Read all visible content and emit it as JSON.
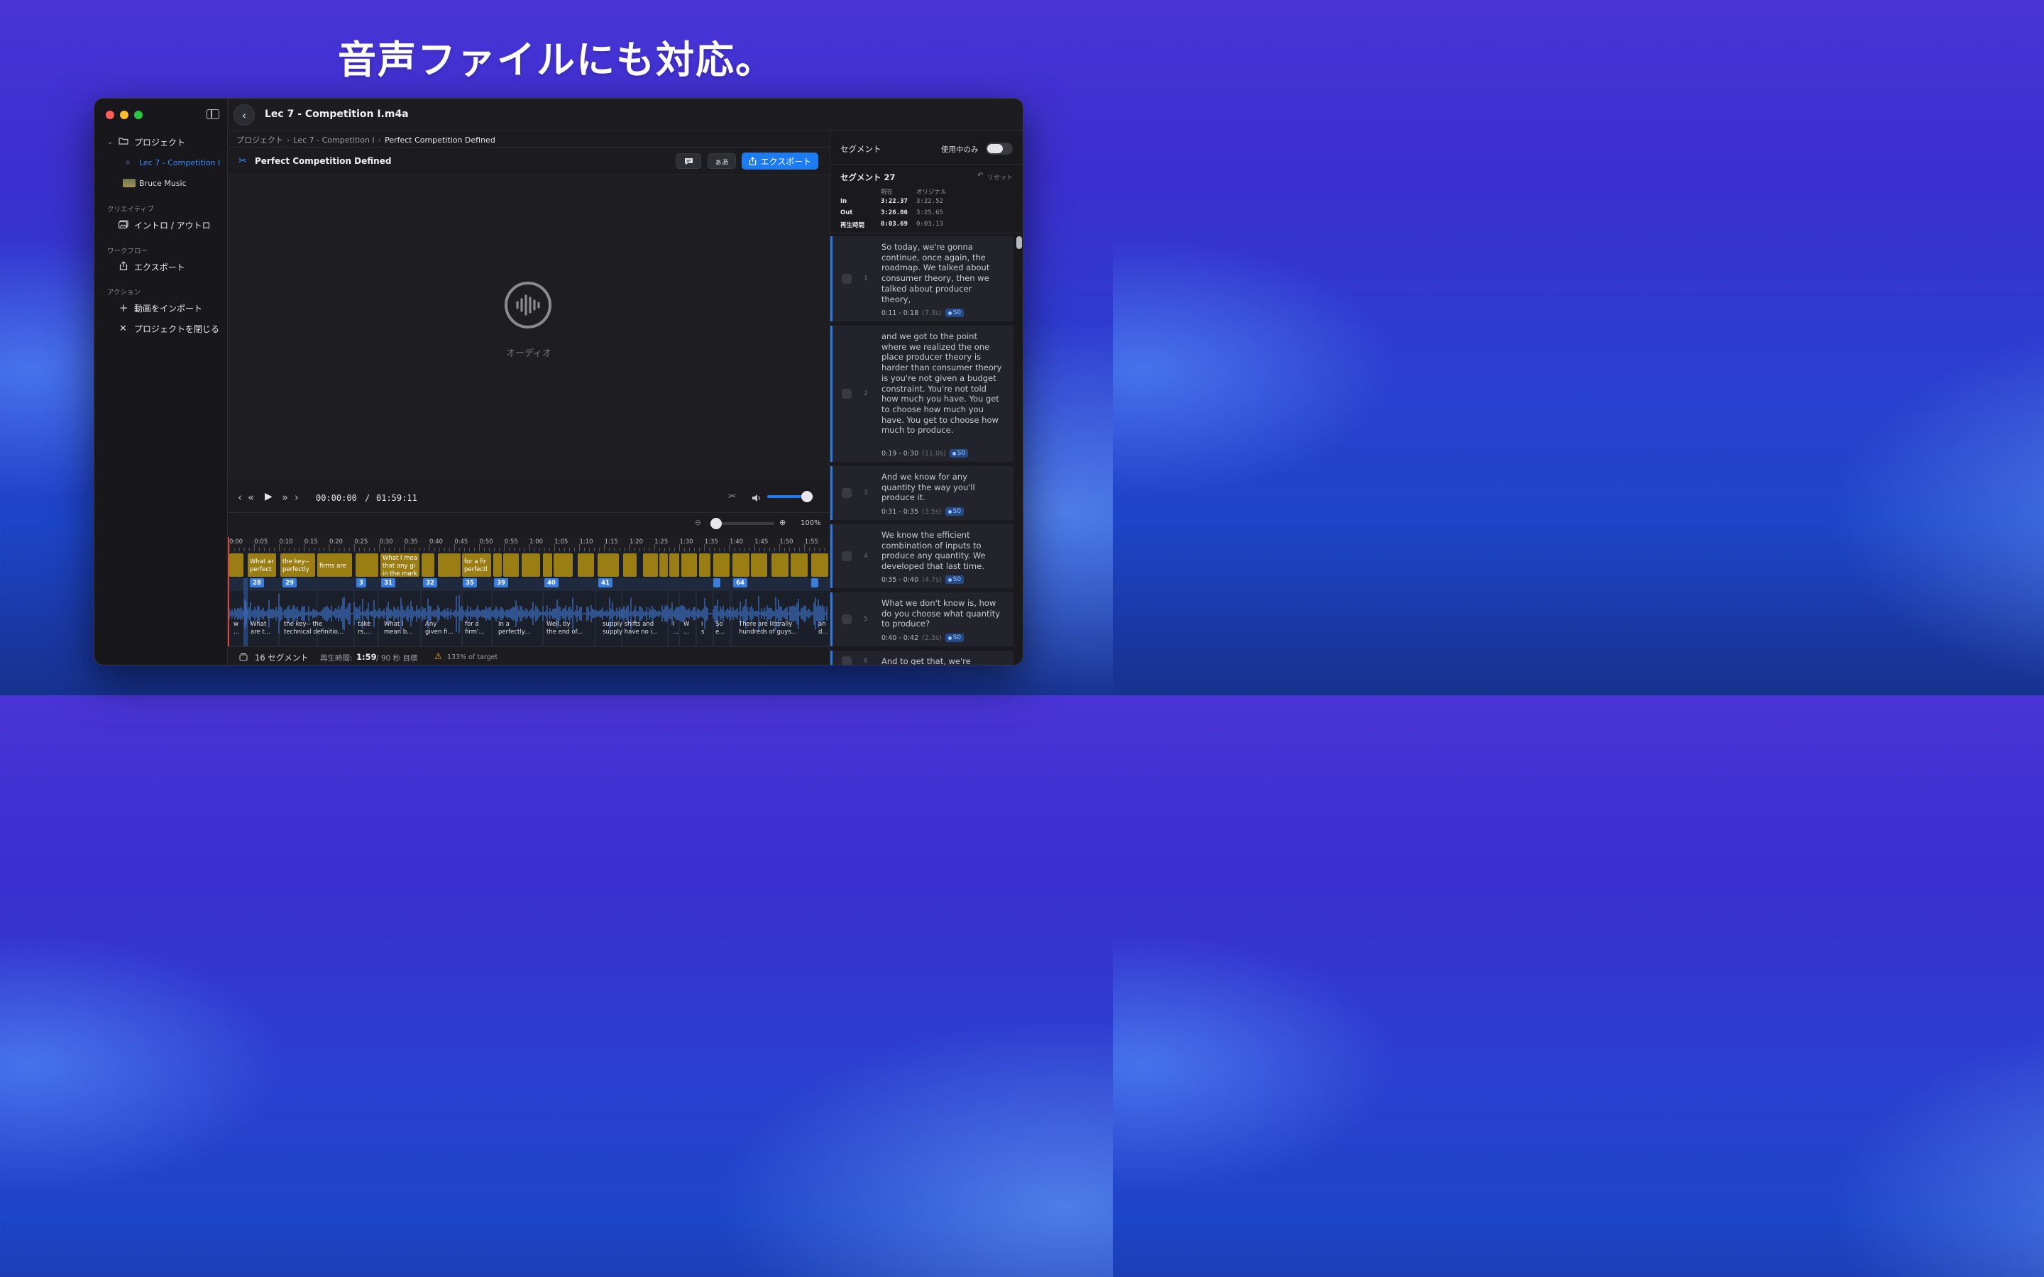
{
  "headline": "音声ファイルにも対応。",
  "window": {
    "title": "Lec 7 - Competition I.m4a"
  },
  "sidebar": {
    "project_label": "プロジェクト",
    "project_items": [
      {
        "label": "Lec 7 - Competition I",
        "active": true
      },
      {
        "label": "Bruce Music",
        "active": false
      }
    ],
    "creative_section": "クリエイティブ",
    "creative_item": "イントロ / アウトロ",
    "workflow_section": "ワークフロー",
    "workflow_item": "エクスポート",
    "actions_section": "アクション",
    "action_import": "動画をインポート",
    "action_close": "プロジェクトを閉じる"
  },
  "breadcrumb": [
    "プロジェクト",
    "Lec 7 - Competition I",
    "Perfect Competition Defined"
  ],
  "toolbar": {
    "title": "Perfect Competition Defined",
    "caption_btn_icon": "speech-bubble-icon",
    "font_btn_label": "ぁあ",
    "export_label": "エクスポート"
  },
  "player": {
    "audio_label": "オーディオ",
    "current_time": "00:00:00",
    "separator": "/",
    "total_time": "01:59:11",
    "volume_level": 0.85,
    "zoom_level_label": "100%",
    "zoom_value": 0.0
  },
  "timeline": {
    "ticks": [
      "0:00",
      "0:05",
      "0:10",
      "0:15",
      "0:20",
      "0:25",
      "0:30",
      "0:35",
      "0:40",
      "0:45",
      "0:50",
      "0:55",
      "1:00",
      "1:05",
      "1:10",
      "1:15",
      "1:20",
      "1:25",
      "1:30",
      "1:35",
      "1:40",
      "1:45",
      "1:50",
      "1:55"
    ],
    "clips": [
      {
        "label": ""
      },
      {
        "label": "What ar perfect"
      },
      {
        "label": "the key-- perfectly"
      },
      {
        "label": "firms are"
      },
      {
        "label": ""
      },
      {
        "label": "What I mea that any gi in the mark"
      },
      {
        "label": ""
      },
      {
        "label": ""
      },
      {
        "label": "for a fir perfectl"
      },
      {
        "label": ""
      },
      {
        "label": ""
      },
      {
        "label": ""
      },
      {
        "label": ""
      },
      {
        "label": ""
      },
      {
        "label": ""
      },
      {
        "label": ""
      },
      {
        "label": ""
      },
      {
        "label": ""
      },
      {
        "label": ""
      },
      {
        "label": ""
      },
      {
        "label": ""
      },
      {
        "label": ""
      },
      {
        "label": ""
      },
      {
        "label": ""
      },
      {
        "label": ""
      },
      {
        "label": ""
      },
      {
        "label": ""
      }
    ],
    "markers": [
      "28",
      "29",
      "3",
      "31",
      "32",
      "35",
      "39",
      "40",
      "41",
      "",
      "64",
      ""
    ],
    "captions": [
      {
        "l1": "w",
        "l2": "..."
      },
      {
        "l1": "What",
        "l2": "are t..."
      },
      {
        "l1": "the key-- the",
        "l2": "technical definitio..."
      },
      {
        "l1": "take",
        "l2": "rs...."
      },
      {
        "l1": "What I",
        "l2": "mean b..."
      },
      {
        "l1": "Any",
        "l2": "given fi..."
      },
      {
        "l1": "for a",
        "l2": "firm'..."
      },
      {
        "l1": "In a",
        "l2": "perfectly..."
      },
      {
        "l1": "Well, by",
        "l2": "the end of..."
      },
      {
        "l1": "supply shifts and",
        "l2": "supply have no i..."
      },
      {
        "l1": "I",
        "l2": "..."
      },
      {
        "l1": "W",
        "l2": "..."
      },
      {
        "l1": "i",
        "l2": "s"
      },
      {
        "l1": "So",
        "l2": "e..."
      },
      {
        "l1": "There are literally",
        "l2": "hundreds of guys..."
      },
      {
        "l1": "an",
        "l2": "d..."
      }
    ]
  },
  "status": {
    "segments": "16 セグメント",
    "duration_prefix": "再生時間:",
    "duration_value": "1:59",
    "duration_suffix": "/ 90 秒 目標",
    "warning": "133% of target"
  },
  "right_panel": {
    "header": "セグメント",
    "toggle_label": "使用中のみ",
    "toggle_on": false,
    "segment_title": "セグメント 27",
    "reset_label": "リセット",
    "col_current": "現在",
    "col_original": "オリジナル",
    "rows": [
      {
        "label": "In",
        "current": "3:22.37",
        "original": "3:22.52"
      },
      {
        "label": "Out",
        "current": "3:26.06",
        "original": "3:25.65"
      },
      {
        "label": "再生時間",
        "current": "0:03.69",
        "original": "0:03.13"
      }
    ],
    "segments": [
      {
        "num": "1",
        "text": "So today, we're gonna continue, once again, the roadmap. We talked about consumer theory, then we talked about producer theory,",
        "range": "0:11 - 0:18",
        "dur": "(7.3s)",
        "badge": "S0"
      },
      {
        "num": "2",
        "text": "and we got to the point where we realized the one place producer theory is harder than consumer theory is you're not given a budget constraint. You're not told how much you have. You get to choose how much you have. You get to choose how much to produce.",
        "range": "0:19 - 0:30",
        "dur": "(11.0s)",
        "badge": "S0"
      },
      {
        "num": "3",
        "text": "And we know for any quantity the way you'll produce it.",
        "range": "0:31 - 0:35",
        "dur": "(3.5s)",
        "badge": "S0"
      },
      {
        "num": "4",
        "text": "We know the efficient combination of inputs to produce any quantity. We developed that last time.",
        "range": "0:35 - 0:40",
        "dur": "(4.7s)",
        "badge": "S0"
      },
      {
        "num": "5",
        "text": "What we don't know is, how do you choose what quantity to produce?",
        "range": "0:40 - 0:42",
        "dur": "(2.3s)",
        "badge": "S0"
      },
      {
        "num": "6",
        "text": "And to get that, we're",
        "range": "",
        "dur": "",
        "badge": ""
      }
    ]
  },
  "colors": {
    "accent": "#1e7cf2",
    "clip": "#9a7e14",
    "wave": "#3d6fc4",
    "marker": "#3b7ddd"
  }
}
